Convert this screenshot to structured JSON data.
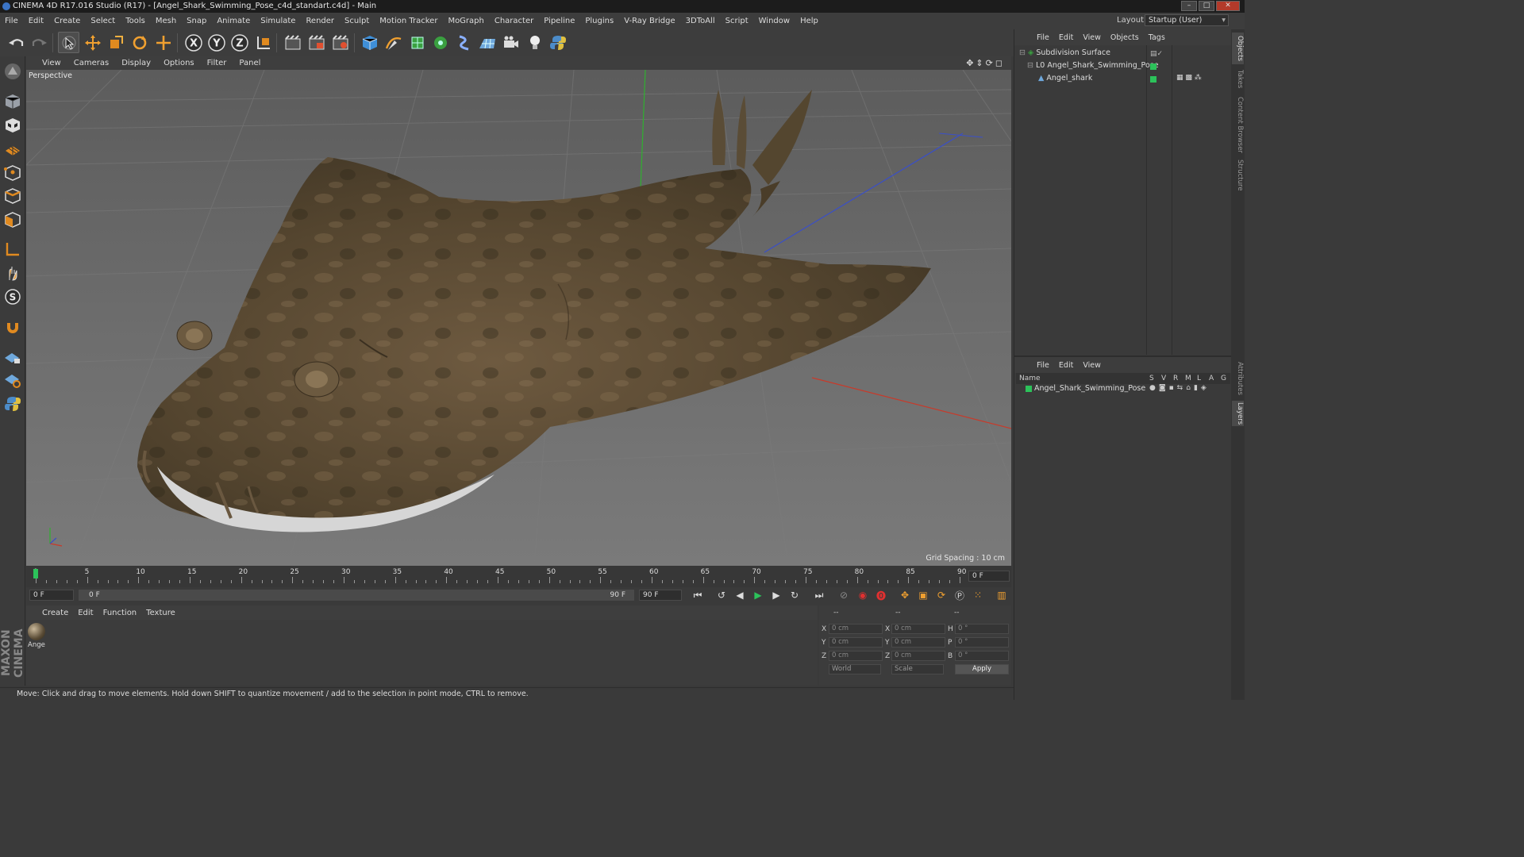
{
  "window": {
    "title": "CINEMA 4D R17.016 Studio (R17) - [Angel_Shark_Swimming_Pose_c4d_standart.c4d] - Main"
  },
  "menu": [
    "File",
    "Edit",
    "Create",
    "Select",
    "Tools",
    "Mesh",
    "Snap",
    "Animate",
    "Simulate",
    "Render",
    "Sculpt",
    "Motion Tracker",
    "MoGraph",
    "Character",
    "Pipeline",
    "Plugins",
    "V-Ray Bridge",
    "3DToAll",
    "Script",
    "Window",
    "Help"
  ],
  "layout": {
    "label": "Layout:",
    "value": "Startup (User)"
  },
  "toolbar": {
    "x_label": "X",
    "y_label": "Y",
    "z_label": "Z"
  },
  "viewport": {
    "menu": [
      "View",
      "Cameras",
      "Display",
      "Options",
      "Filter",
      "Panel"
    ],
    "label": "Perspective",
    "grid_spacing": "Grid Spacing : 10 cm"
  },
  "timeline": {
    "ticks": [
      "0",
      "5",
      "10",
      "15",
      "20",
      "25",
      "30",
      "35",
      "40",
      "45",
      "50",
      "55",
      "60",
      "65",
      "70",
      "75",
      "80",
      "85",
      "90"
    ],
    "current_frame": "0 F",
    "start_field": "0 F",
    "range_start": "0 F",
    "range_end": "90 F",
    "end_field": "90 F"
  },
  "material": {
    "menu": [
      "Create",
      "Edit",
      "Function",
      "Texture"
    ],
    "item_label": "Ange"
  },
  "coords": {
    "headers": [
      "--",
      "--",
      "--"
    ],
    "rows": [
      {
        "a": "X",
        "av": "0 cm",
        "b": "X",
        "bv": "0 cm",
        "c": "H",
        "cv": "0 °"
      },
      {
        "a": "Y",
        "av": "0 cm",
        "b": "Y",
        "bv": "0 cm",
        "c": "P",
        "cv": "0 °"
      },
      {
        "a": "Z",
        "av": "0 cm",
        "b": "Z",
        "bv": "0 cm",
        "c": "B",
        "cv": "0 °"
      }
    ],
    "world": "World",
    "scale": "Scale",
    "apply": "Apply"
  },
  "status": "Move: Click and drag to move elements. Hold down SHIFT to quantize movement / add to the selection in point mode, CTRL to remove.",
  "objects": {
    "menu": [
      "File",
      "Edit",
      "View",
      "Objects",
      "Tags"
    ],
    "items": [
      "Subdivision Surface",
      "Angel_Shark_Swimming_Pose",
      "Angel_shark"
    ]
  },
  "layers": {
    "menu": [
      "File",
      "Edit",
      "View"
    ],
    "name_header": "Name",
    "cols": [
      "S",
      "V",
      "R",
      "M",
      "L",
      "A",
      "G"
    ],
    "items": [
      "Angel_Shark_Swimming_Pose"
    ]
  },
  "side_tabs": [
    "Objects",
    "Takes",
    "Content Browser",
    "Structure",
    "Attributes",
    "Layers"
  ],
  "branding": "MAXON CINEMA 4D",
  "colors": {
    "accent": "#2cc25a",
    "axis_x": "#c83a2a",
    "axis_y": "#2fb02f",
    "axis_z": "#3a4fc8"
  }
}
